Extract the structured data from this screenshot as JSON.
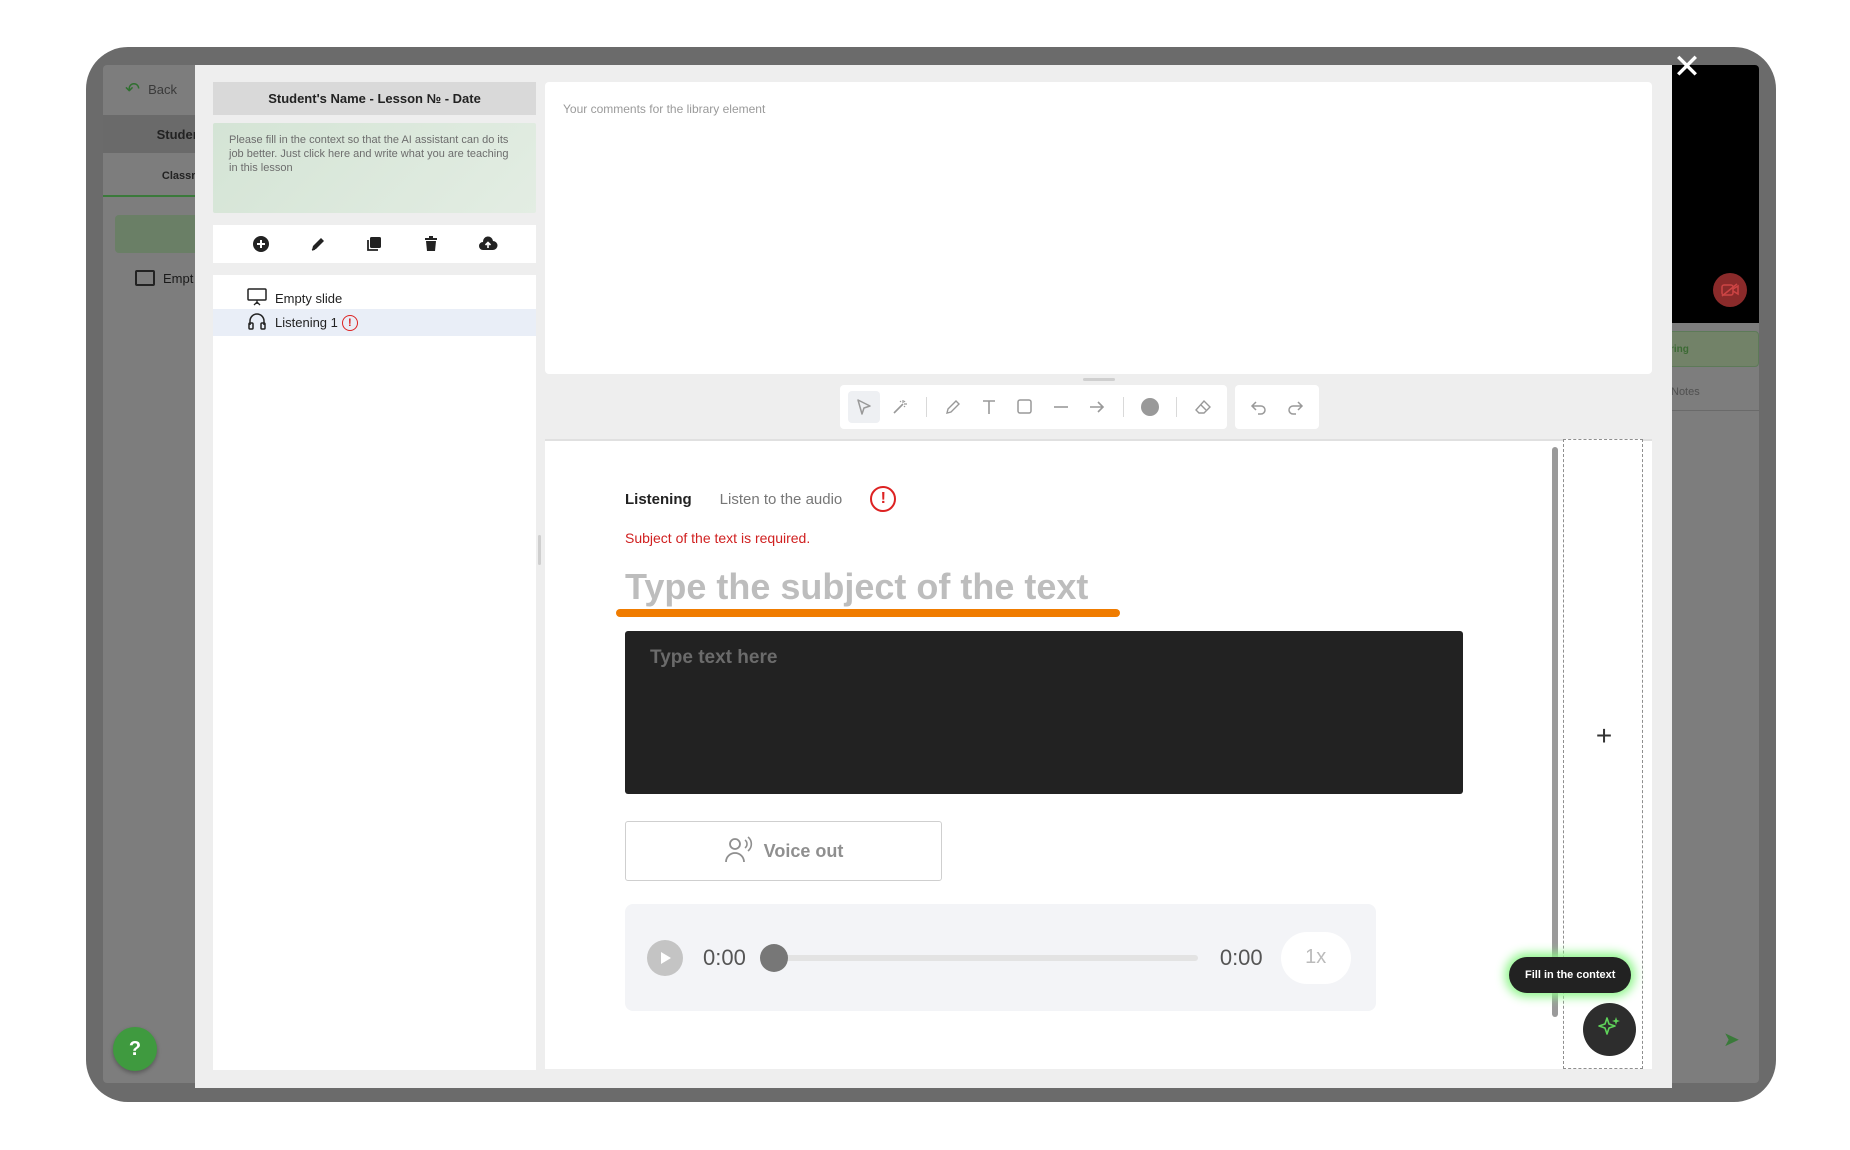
{
  "background_app": {
    "back_label": "Back",
    "student_tab": "Student",
    "classroom_tab": "Classroo",
    "empty_item": "Empt",
    "help_label": "?",
    "green_button_fragment": "ring",
    "notes_tab": "Notes"
  },
  "modal": {
    "lesson_title": "Student's Name - Lesson № - Date",
    "ai_context_hint": "Please fill in the context so that the AI assistant can do its job better. Just click here and write what you are teaching in this lesson",
    "toolbar_icons": [
      "add-icon",
      "edit-icon",
      "duplicate-icon",
      "delete-icon",
      "upload-icon"
    ],
    "slides": [
      {
        "label": "Empty slide",
        "icon": "presentation-icon"
      },
      {
        "label": "Listening 1",
        "icon": "headphones-icon",
        "warning": "!"
      }
    ],
    "comments_placeholder": "Your comments for the library element",
    "draw_tools": [
      "select",
      "magic-wand",
      "pencil",
      "text",
      "rectangle",
      "line",
      "arrow",
      "color",
      "eraser",
      "undo",
      "redo"
    ]
  },
  "slide": {
    "tab_listening": "Listening",
    "tab_listen_audio": "Listen to the audio",
    "warning_glyph": "!",
    "error_message": "Subject of the text is required.",
    "subject_placeholder": "Type the subject of the text",
    "text_placeholder": "Type text here",
    "voice_out_label": "Voice out",
    "player": {
      "current_time": "0:00",
      "duration": "0:00",
      "speed": "1x",
      "progress": 0
    }
  },
  "add_zone": {
    "plus": "+"
  },
  "fill_context_label": "Fill in the context",
  "close_label": "✕",
  "colors": {
    "accent_green": "#3f9a3f",
    "error_red": "#d02020",
    "subject_underline": "#f07c00"
  }
}
